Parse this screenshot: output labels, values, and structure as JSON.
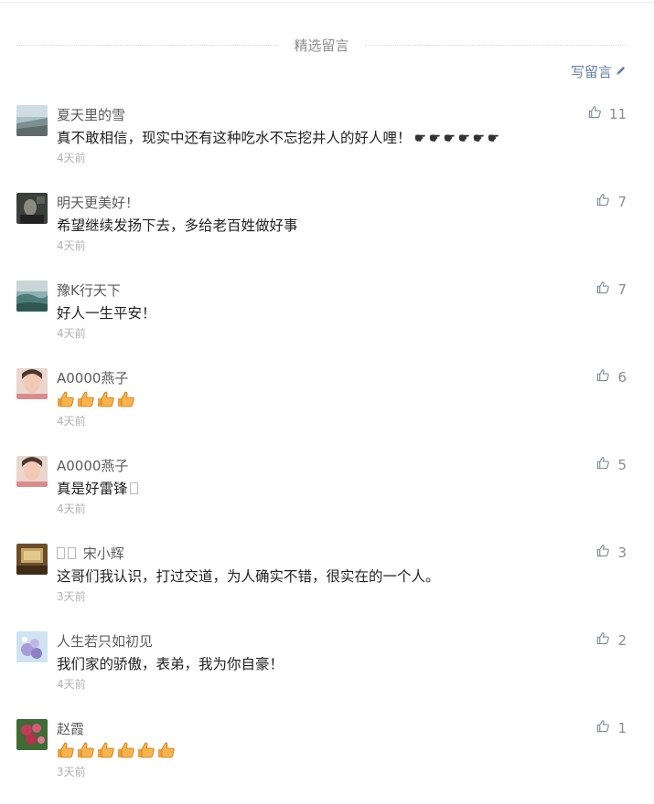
{
  "section": {
    "title": "精选留言",
    "write_label": "写留言"
  },
  "comments": [
    {
      "nickname": "夏天里的雪",
      "text": "真不敢相信，现实中还有这种吃水不忘挖井人的好人哩！",
      "emoji": "point-right-x6",
      "time": "4天前",
      "likes": "11",
      "avatar": "landscape-gray"
    },
    {
      "nickname": "明天更美好！",
      "text": "希望继续发扬下去，多给老百姓做好事",
      "time": "4天前",
      "likes": "7",
      "avatar": "dark-portrait"
    },
    {
      "nickname": "豫K行天下",
      "text": "好人一生平安！",
      "time": "4天前",
      "likes": "7",
      "avatar": "teal-landscape"
    },
    {
      "nickname": "A0000燕子",
      "text": "",
      "emoji": "thumbs-up-x4",
      "time": "4天前",
      "likes": "6",
      "avatar": "woman-portrait"
    },
    {
      "nickname": "A0000燕子",
      "text": "真是好雷锋",
      "time": "4天前",
      "likes": "5",
      "avatar": "woman-portrait"
    },
    {
      "nickname": "宋小辉",
      "text": "这哥们我认识，打过交道，为人确实不错，很实在的一个人。",
      "time": "3天前",
      "likes": "3",
      "avatar": "brown-room"
    },
    {
      "nickname": "人生若只如初见",
      "text": "我们家的骄傲，表弟，我为你自豪！",
      "time": "4天前",
      "likes": "2",
      "avatar": "blue-flowers"
    },
    {
      "nickname": "赵霞",
      "text": "",
      "emoji": "thumbs-up-x6",
      "time": "3天前",
      "likes": "1",
      "avatar": "pink-roses"
    }
  ],
  "colors": {
    "link": "#607fa6",
    "muted": "#8c8c8c",
    "time": "#b2b2b2"
  },
  "icons": {
    "like": "thumb-up-outline-icon",
    "write": "pencil-icon"
  }
}
